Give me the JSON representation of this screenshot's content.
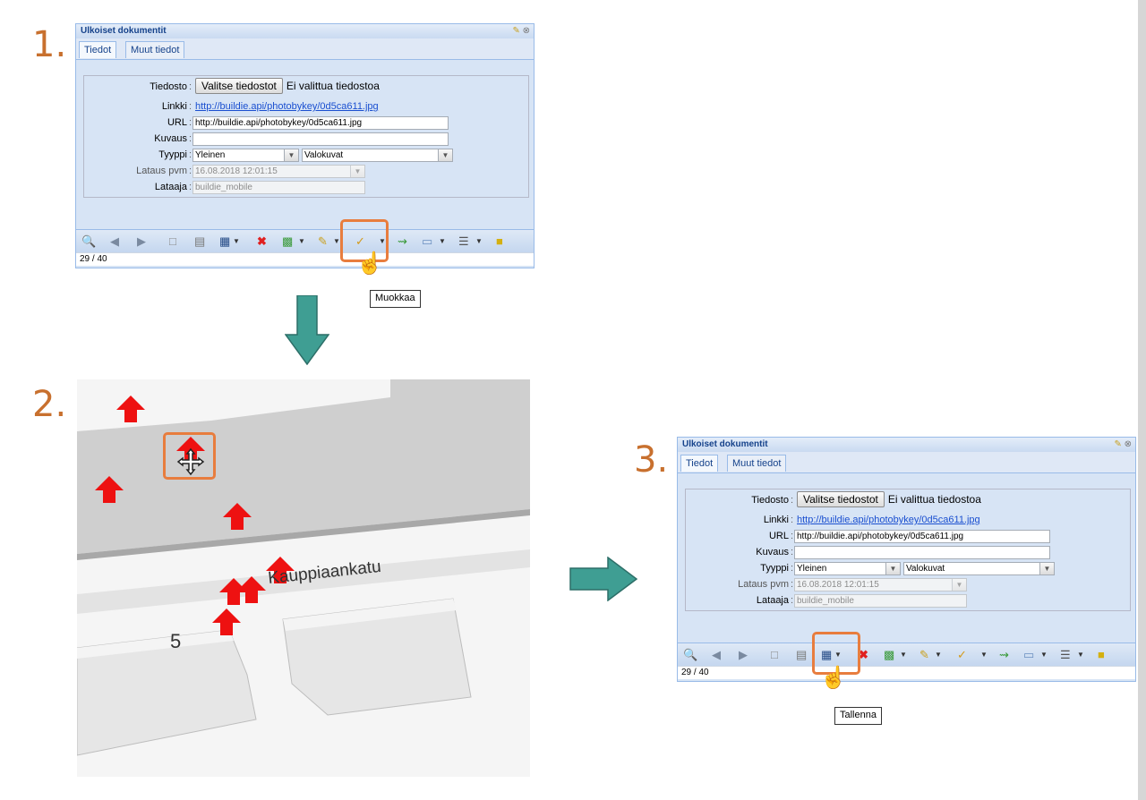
{
  "steps": {
    "one": "1.",
    "two": "2.",
    "three": "3."
  },
  "window": {
    "title": "Ulkoiset dokumentit",
    "tabs": [
      "Tiedot",
      "Muut tiedot"
    ]
  },
  "form": {
    "file_label": "Tiedosto",
    "file_button": "Valitse tiedostot",
    "no_file_text": "Ei valittua tiedostoa",
    "link_label": "Linkki",
    "link_value": "http://buildie.api/photobykey/0d5ca611.jpg",
    "url_label": "URL",
    "url_value": "http://buildie.api/photobykey/0d5ca611.jpg",
    "desc_label": "Kuvaus",
    "desc_value": "",
    "type_label": "Tyyppi",
    "type_value": "Yleinen",
    "subtype_value": "Valokuvat",
    "date_label": "Lataus pvm",
    "date_value": "16.08.2018 12:01:15",
    "uploader_label": "Lataaja",
    "uploader_value": "buildie_mobile"
  },
  "status": {
    "record": "29 / 40"
  },
  "tooltips": {
    "edit": "Muokkaa",
    "save": "Tallenna"
  },
  "map": {
    "street_label": "Kauppiaankatu",
    "block_number": "5"
  },
  "toolbar_icons": [
    "search-icon",
    "prev-icon",
    "next-icon",
    "new-doc-icon",
    "form-icon",
    "save-icon",
    "dropdown-arrow",
    "delete-icon",
    "select-icon",
    "dropdown-arrow",
    "tool-icon",
    "dropdown-arrow",
    "edit-icon",
    "dropdown-arrow",
    "link-icon",
    "export-icon",
    "dropdown-arrow",
    "list-icon",
    "dropdown-arrow",
    "note-icon"
  ],
  "colors": {
    "accent_orange": "#e87d3e",
    "step_orange": "#c8702e",
    "arrow_teal": "#3f9e93",
    "marker_red": "#ee1111"
  }
}
